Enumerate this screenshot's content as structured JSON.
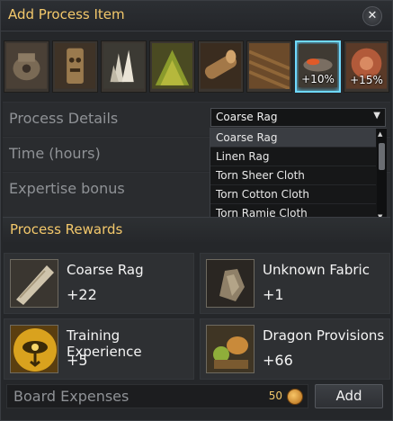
{
  "window": {
    "title": "Add Process Item",
    "close_label": "✕"
  },
  "material_tiles": [
    {
      "icon": "stone-mill-icon",
      "percent": ""
    },
    {
      "icon": "wooden-totem-icon",
      "percent": ""
    },
    {
      "icon": "quartz-crystal-icon",
      "percent": ""
    },
    {
      "icon": "green-leaves-icon",
      "percent": ""
    },
    {
      "icon": "timber-log-icon",
      "percent": ""
    },
    {
      "icon": "wood-plank-icon",
      "percent": ""
    },
    {
      "icon": "torch-flame-icon",
      "percent": "+10%"
    },
    {
      "icon": "coin-stack-icon",
      "percent": "+15%"
    }
  ],
  "process": {
    "details_label": "Process Details",
    "time_label": "Time (hours)",
    "expertise_label": "Expertise bonus",
    "selected_item": "Coarse Rag",
    "options": [
      "Coarse Rag",
      "Linen Rag",
      "Torn Sheer Cloth",
      "Torn Cotton Cloth",
      "Torn Ramie Cloth"
    ]
  },
  "rewards": {
    "heading": "Process Rewards",
    "items": [
      {
        "name": "Coarse Rag",
        "amount": "+22",
        "icon": "coarse-rag-icon"
      },
      {
        "name": "Unknown Fabric",
        "amount": "+1",
        "icon": "unknown-fabric-icon"
      },
      {
        "name": "Training Experience",
        "amount": "+5",
        "icon": "eye-sigil-icon"
      },
      {
        "name": "Dragon Provisions",
        "amount": "+66",
        "icon": "dragon-provisions-icon"
      }
    ]
  },
  "footer": {
    "board_label": "Board Expenses",
    "board_cost": "50",
    "add_label": "Add"
  },
  "colors": {
    "accent_gold": "#f3c86b",
    "selection_cyan": "#6fd9ff",
    "panel": "#25272a"
  }
}
